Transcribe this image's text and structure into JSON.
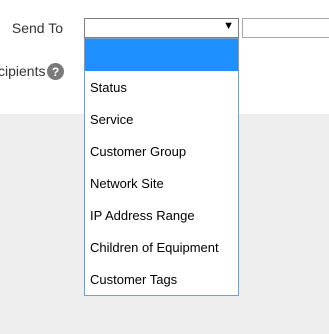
{
  "form": {
    "send_to_label": "Send To",
    "recipients_label": "cipients",
    "help_icon_glyph": "?"
  },
  "select": {
    "value": "",
    "arrow_glyph": "▼",
    "options": [
      "",
      "Status",
      "Service",
      "Customer Group",
      "Network Site",
      "IP Address Range",
      "Children of Equipment",
      "Customer Tags"
    ],
    "highlight_color": "#1e90ff"
  },
  "text_input": {
    "value": ""
  }
}
